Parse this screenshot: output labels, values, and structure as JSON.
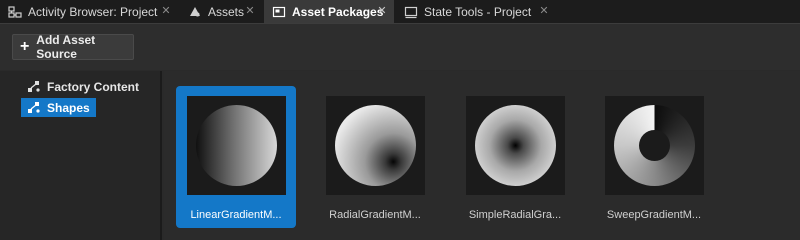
{
  "tabs": [
    {
      "label": "Activity Browser: Project",
      "icon": "activity-browser-icon",
      "active": false
    },
    {
      "label": "Assets",
      "icon": "assets-icon",
      "active": false
    },
    {
      "label": "Asset Packages",
      "icon": "asset-packages-icon",
      "active": true
    },
    {
      "label": "State Tools - Project",
      "icon": "state-tools-icon",
      "active": false
    }
  ],
  "toolbar": {
    "add_asset_source_label": "Add Asset Source"
  },
  "tree": {
    "items": [
      {
        "label": "Factory Content",
        "icon": "package-icon",
        "selected": false
      },
      {
        "label": "Shapes",
        "icon": "package-icon",
        "selected": true
      }
    ]
  },
  "assets": [
    {
      "label": "LinearGradientM...",
      "selected": true,
      "gradient": "linear"
    },
    {
      "label": "RadialGradientM...",
      "selected": false,
      "gradient": "radial"
    },
    {
      "label": "SimpleRadialGra...",
      "selected": false,
      "gradient": "simple-radial"
    },
    {
      "label": "SweepGradientM...",
      "selected": false,
      "gradient": "sweep"
    }
  ],
  "colors": {
    "accent": "#1478c8",
    "background": "#2b2b2b",
    "tab_bar": "#1c1c1c"
  }
}
